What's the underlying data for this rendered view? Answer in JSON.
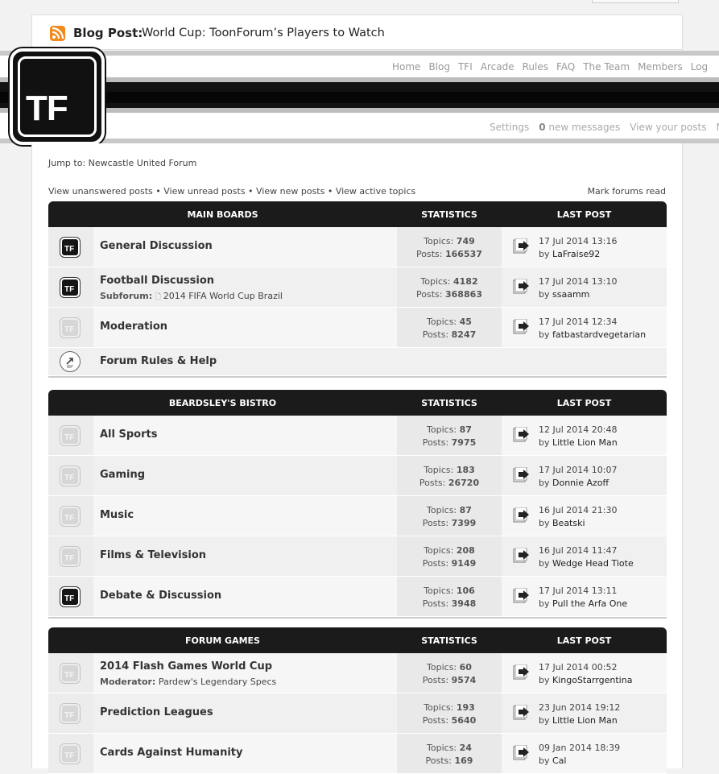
{
  "blog": {
    "label": "Blog Post:",
    "title": "World Cup: ToonForum’s Players to Watch"
  },
  "logo_text": "TF",
  "nav": [
    "Home",
    "Blog",
    "TFI",
    "Arcade",
    "Rules",
    "FAQ",
    "The Team",
    "Members",
    "Log"
  ],
  "subnav": {
    "settings": "Settings",
    "msg_count": "0",
    "msg_label": "new messages",
    "view_posts": "View your posts",
    "more": "M"
  },
  "jump": "Jump to: Newcastle United Forum",
  "links": "View unanswered posts • View unread posts • View new posts • View active topics",
  "mark_read": "Mark forums read",
  "labels": {
    "topics": "Topics:",
    "posts": "Posts:",
    "by": "by",
    "subforum": "Subforum:",
    "moderator": "Moderator:"
  },
  "sections": [
    {
      "title": "MAIN BOARDS",
      "stats": "STATISTICS",
      "last": "LAST POST",
      "forums": [
        {
          "name": "General Discussion",
          "topics": "749",
          "posts": "166537",
          "date": "17 Jul 2014 13:16",
          "user": "LaFraise92",
          "icon": "new"
        },
        {
          "name": "Football Discussion",
          "sub": "2014 FIFA World Cup Brazil",
          "topics": "4182",
          "posts": "368863",
          "date": "17 Jul 2014 13:10",
          "user": "ssaamm",
          "icon": "new"
        },
        {
          "name": "Moderation",
          "topics": "45",
          "posts": "8247",
          "date": "17 Jul 2014 12:34",
          "user": "fatbastardvegetarian",
          "icon": "old"
        },
        {
          "name": "Forum Rules & Help",
          "icon": "rules"
        }
      ]
    },
    {
      "title": "BEARDSLEY'S BISTRO",
      "stats": "STATISTICS",
      "last": "LAST POST",
      "forums": [
        {
          "name": "All Sports",
          "topics": "87",
          "posts": "7975",
          "date": "12 Jul 2014 20:48",
          "user": "Little Lion Man",
          "icon": "old"
        },
        {
          "name": "Gaming",
          "topics": "183",
          "posts": "26720",
          "date": "17 Jul 2014 10:07",
          "user": "Donnie Azoff",
          "icon": "old"
        },
        {
          "name": "Music",
          "topics": "87",
          "posts": "7399",
          "date": "16 Jul 2014 21:30",
          "user": "Beatski",
          "icon": "old"
        },
        {
          "name": "Films & Television",
          "topics": "208",
          "posts": "9149",
          "date": "16 Jul 2014 11:47",
          "user": "Wedge Head Tiote",
          "icon": "old"
        },
        {
          "name": "Debate & Discussion",
          "topics": "106",
          "posts": "3948",
          "date": "17 Jul 2014 13:11",
          "user": "Pull the Arfa One",
          "icon": "new"
        }
      ]
    },
    {
      "title": "FORUM GAMES",
      "stats": "STATISTICS",
      "last": "LAST POST",
      "forums": [
        {
          "name": "2014 Flash Games World Cup",
          "mod": "Pardew's Legendary Specs",
          "topics": "60",
          "posts": "9574",
          "date": "17 Jul 2014 00:52",
          "user": "KingoStarrgentina",
          "icon": "old"
        },
        {
          "name": "Prediction Leagues",
          "topics": "193",
          "posts": "5640",
          "date": "23 Jun 2014 19:12",
          "user": "Little Lion Man",
          "icon": "old"
        },
        {
          "name": "Cards Against Humanity",
          "topics": "24",
          "posts": "169",
          "date": "09 Jan 2014 18:39",
          "user": "Cal",
          "icon": "old"
        }
      ]
    }
  ]
}
